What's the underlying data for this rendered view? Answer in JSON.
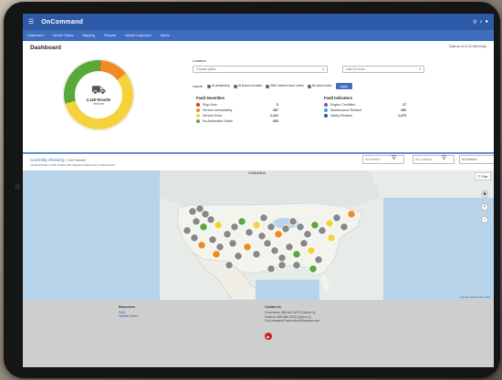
{
  "app": {
    "logo": "OnCommand",
    "icons": [
      "search-icon",
      "bell-icon",
      "user-icon"
    ]
  },
  "nav": {
    "items": [
      "Dashboard",
      "Vehicle Status",
      "Mapping",
      "Reports",
      "Vehicle Inspection",
      "Admin"
    ]
  },
  "dashboard": {
    "title": "Dashboard",
    "as_of": "Data as of 11:10 AM today"
  },
  "summary": {
    "results": "2,145 Results",
    "vehicles_label": "Vehicles",
    "donut": [
      {
        "label": "Stop Now",
        "value": 5,
        "color": "#d9342b"
      },
      {
        "label": "Service Immediately",
        "value": 287,
        "color": "#f08a24"
      },
      {
        "label": "Service Soon",
        "value": 1221,
        "color": "#f4d23c"
      },
      {
        "label": "No Actionable Faults",
        "value": 652,
        "color": "#5aa83a"
      }
    ]
  },
  "locations": {
    "label": "Locations",
    "select_value": "Choose option",
    "period_value": "Last 24 hours"
  },
  "filters": {
    "include_label": "Include:",
    "options": [
      "At dealership",
      "At known location",
      "With inactive fault codes",
      "No fault codes"
    ],
    "apply_label": "Apply"
  },
  "severities": {
    "title": "Fault Severities",
    "rows": [
      {
        "label": "Stop Now",
        "value": "5",
        "color": "#d9342b"
      },
      {
        "label": "Service Immediately",
        "value": "287",
        "color": "#f08a24"
      },
      {
        "label": "Service Soon",
        "value": "1,221",
        "color": "#f4d23c"
      },
      {
        "label": "No Actionable Faults",
        "value": "652",
        "color": "#5aa83a"
      }
    ]
  },
  "indicators": {
    "title": "Fault Indicators",
    "rows": [
      {
        "label": "Engine Condition",
        "value": "17",
        "color": "#8c4bb3"
      },
      {
        "label": "Maintenance Related",
        "value": "192",
        "color": "#3aa5c9"
      },
      {
        "label": "Safety Related",
        "value": "1,372",
        "color": "#2d5aa6"
      }
    ]
  },
  "map_section": {
    "showing_title": "Currently Showing:",
    "showing_count": "2,145 Vehicles",
    "showing_sub": "Combined Fleet: 2,145 vehicles with mapped locations from 2 data sources",
    "search1_placeholder": "All Vehicles",
    "search2_placeholder": "All Locations",
    "sort_value": "All Vehicles",
    "canada_label": "CANADA",
    "filter_label": "Filter",
    "attribution": "Map data ©2022 Google, INEGI"
  },
  "footer": {
    "resources_title": "Resources",
    "resources_links": [
      "FAQ",
      "Vehicle Video"
    ],
    "contact_title": "Contact Us",
    "contact_lines": [
      "Customers: 888-667-6275 (Option 3)",
      "Dealers: 800-580-3330 (Option 4)",
      "OnCommandConnection@Navistar.com"
    ]
  }
}
